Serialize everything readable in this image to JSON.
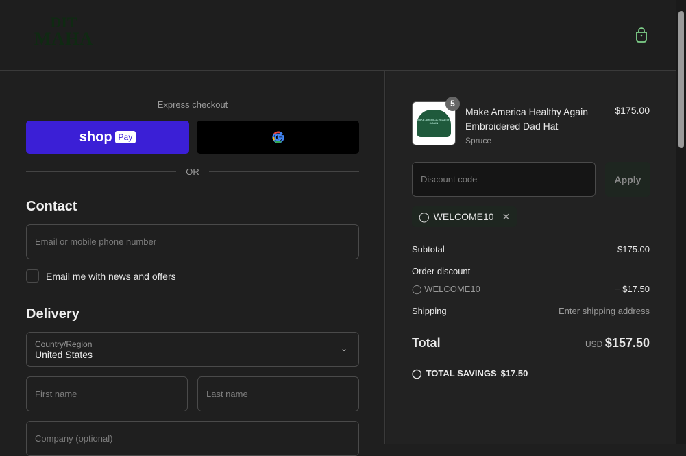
{
  "logo": {
    "text_line1": "DIT",
    "text_line2": "MAHA"
  },
  "express": {
    "title": "Express checkout",
    "shop_label": "shop",
    "pay_label": "Pay",
    "or": "OR"
  },
  "contact": {
    "heading": "Contact",
    "email_placeholder": "Email or mobile phone number",
    "newsletter_label": "Email me with news and offers"
  },
  "delivery": {
    "heading": "Delivery",
    "country_label": "Country/Region",
    "country_value": "United States",
    "first_name": "First name",
    "last_name": "Last name",
    "company": "Company (optional)"
  },
  "cart": {
    "item": {
      "title_line1": "Make America Healthy Again",
      "title_line2": "Embroidered Dad Hat",
      "variant": "Spruce",
      "quantity": "5",
      "price": "$175.00",
      "image_text": "MAKE AMERICA HEALTHY AGAIN"
    },
    "discount_placeholder": "Discount code",
    "apply": "Apply",
    "applied_code": "WELCOME10",
    "subtotal_label": "Subtotal",
    "subtotal": "$175.00",
    "order_discount_label": "Order discount",
    "discount_code": "WELCOME10",
    "discount_amount": "− $17.50",
    "shipping_label": "Shipping",
    "shipping_value": "Enter shipping address",
    "total_label": "Total",
    "currency": "USD",
    "total": "$157.50",
    "savings_label": "TOTAL SAVINGS",
    "savings": "$17.50"
  },
  "colors": {
    "shop_pay": "#3b1fd6",
    "accent": "#7fd08a"
  }
}
